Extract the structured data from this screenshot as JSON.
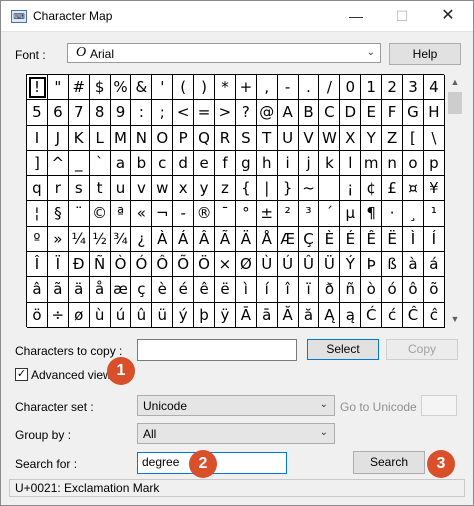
{
  "window": {
    "title": "Character Map",
    "controls": {
      "minimize": "—",
      "maximize": "☐",
      "close": "✕"
    },
    "app_icon": "character-map-icon"
  },
  "font": {
    "label": "Font :",
    "icon_glyph": "O",
    "value": "Arial"
  },
  "buttons": {
    "help": "Help",
    "select": "Select",
    "copy": "Copy",
    "search": "Search"
  },
  "grid": {
    "rows": [
      [
        "!",
        "\"",
        "#",
        "$",
        "%",
        "&",
        "'",
        "(",
        ")",
        "*",
        "+",
        ",",
        "-",
        ".",
        "/",
        "0",
        "1",
        "2",
        "3",
        "4"
      ],
      [
        "5",
        "6",
        "7",
        "8",
        "9",
        ":",
        ";",
        "<",
        "=",
        ">",
        "?",
        "@",
        "A",
        "B",
        "C",
        "D",
        "E",
        "F",
        "G",
        "H"
      ],
      [
        "I",
        "J",
        "K",
        "L",
        "M",
        "N",
        "O",
        "P",
        "Q",
        "R",
        "S",
        "T",
        "U",
        "V",
        "W",
        "X",
        "Y",
        "Z",
        "[",
        "\\"
      ],
      [
        "]",
        "^",
        "_",
        "`",
        "a",
        "b",
        "c",
        "d",
        "e",
        "f",
        "g",
        "h",
        "i",
        "j",
        "k",
        "l",
        "m",
        "n",
        "o",
        "p"
      ],
      [
        "q",
        "r",
        "s",
        "t",
        "u",
        "v",
        "w",
        "x",
        "y",
        "z",
        "{",
        "|",
        "}",
        "~",
        " ",
        "¡",
        "¢",
        "£",
        "¤",
        "¥"
      ],
      [
        "¦",
        "§",
        "¨",
        "©",
        "ª",
        "«",
        "¬",
        "-",
        "®",
        "¯",
        "°",
        "±",
        "²",
        "³",
        "´",
        "µ",
        "¶",
        "·",
        "¸",
        "¹"
      ],
      [
        "º",
        "»",
        "¼",
        "½",
        "¾",
        "¿",
        "À",
        "Á",
        "Â",
        "Ã",
        "Ä",
        "Å",
        "Æ",
        "Ç",
        "È",
        "É",
        "Ê",
        "Ë",
        "Ì",
        "Í"
      ],
      [
        "Î",
        "Ï",
        "Ð",
        "Ñ",
        "Ò",
        "Ó",
        "Ô",
        "Õ",
        "Ö",
        "×",
        "Ø",
        "Ù",
        "Ú",
        "Û",
        "Ü",
        "Ý",
        "Þ",
        "ß",
        "à",
        "á"
      ],
      [
        "â",
        "ã",
        "ä",
        "å",
        "æ",
        "ç",
        "è",
        "é",
        "ê",
        "ë",
        "ì",
        "í",
        "î",
        "ï",
        "ð",
        "ñ",
        "ò",
        "ó",
        "ô",
        "õ"
      ],
      [
        "ö",
        "÷",
        "ø",
        "ù",
        "ú",
        "û",
        "ü",
        "ý",
        "þ",
        "ÿ",
        "Ā",
        "ā",
        "Ă",
        "ă",
        "Ą",
        "ą",
        "Ć",
        "ć",
        "Ĉ",
        "ĉ"
      ]
    ],
    "selected": "!"
  },
  "copy": {
    "label": "Characters to copy :",
    "value": ""
  },
  "advanced_view": {
    "label": "Advanced view",
    "checked_glyph": "✓"
  },
  "character_set": {
    "label": "Character set :",
    "value": "Unicode"
  },
  "goto_unicode": {
    "label": "Go to Unicode :",
    "value": ""
  },
  "group_by": {
    "label": "Group by :",
    "value": "All"
  },
  "search": {
    "label": "Search for :",
    "value": "degree"
  },
  "status": "U+0021: Exclamation Mark",
  "callouts": [
    "1",
    "2",
    "3"
  ],
  "colors": {
    "callout": "#d94f2a",
    "focus_border": "#0078d7"
  }
}
